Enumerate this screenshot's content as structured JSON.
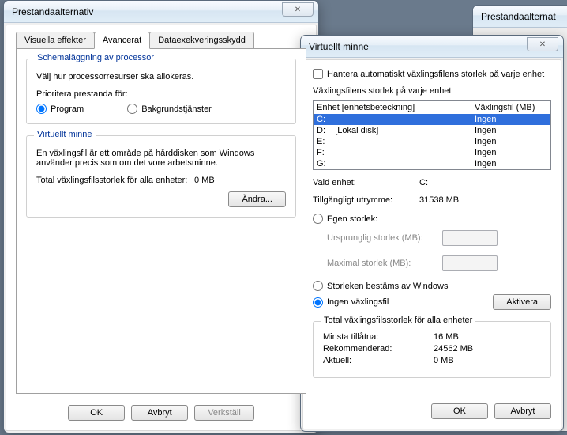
{
  "perf": {
    "title": "Prestandaalternativ",
    "tabs": {
      "visual": "Visuella effekter",
      "advanced": "Avancerat",
      "dep": "Dataexekveringsskydd"
    },
    "sched": {
      "legend": "Schemaläggning av processor",
      "desc": "Välj hur processorresurser ska allokeras.",
      "priority_label": "Prioritera prestanda för:",
      "opt_programs": "Program",
      "opt_bg": "Bakgrundstjänster"
    },
    "vm": {
      "legend": "Virtuellt minne",
      "desc": "En växlingsfil är ett område på hårddisken som Windows använder precis som om det vore arbetsminne.",
      "total_label": "Total växlingsfilsstorlek för alla enheter:",
      "total_value": "0 MB",
      "change_btn": "Ändra..."
    },
    "buttons": {
      "ok": "OK",
      "cancel": "Avbryt",
      "apply": "Verkställ"
    }
  },
  "vmem": {
    "title": "Virtuellt minne",
    "auto_manage": "Hantera automatiskt växlingsfilens storlek på varje enhet",
    "per_drive_label": "Växlingsfilens storlek på varje enhet",
    "header_drive": "Enhet [enhetsbeteckning]",
    "header_page": "Växlingsfil (MB)",
    "drives": [
      {
        "drive": "C:",
        "label": "",
        "page": "Ingen",
        "selected": true
      },
      {
        "drive": "D:",
        "label": "[Lokal disk]",
        "page": "Ingen",
        "selected": false
      },
      {
        "drive": "E:",
        "label": "",
        "page": "Ingen",
        "selected": false
      },
      {
        "drive": "F:",
        "label": "",
        "page": "Ingen",
        "selected": false
      },
      {
        "drive": "G:",
        "label": "",
        "page": "Ingen",
        "selected": false
      }
    ],
    "selected_drive_label": "Vald enhet:",
    "selected_drive_value": "C:",
    "space_label": "Tillgängligt utrymme:",
    "space_value": "31538 MB",
    "opt_custom": "Egen storlek:",
    "initial_label": "Ursprunglig storlek (MB):",
    "max_label": "Maximal storlek (MB):",
    "opt_system": "Storleken bestäms av Windows",
    "opt_none": "Ingen växlingsfil",
    "set_btn": "Aktivera",
    "totals": {
      "legend": "Total växlingsfilsstorlek för alla enheter",
      "min_label": "Minsta tillåtna:",
      "min_value": "16 MB",
      "rec_label": "Rekommenderad:",
      "rec_value": "24562 MB",
      "cur_label": "Aktuell:",
      "cur_value": "0 MB"
    },
    "buttons": {
      "ok": "OK",
      "cancel": "Avbryt"
    }
  },
  "bgwin_title": "Prestandaalternat"
}
